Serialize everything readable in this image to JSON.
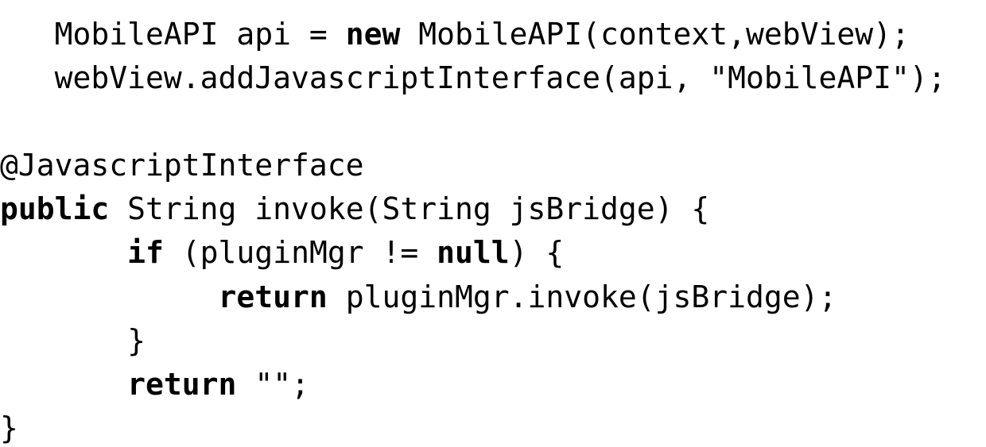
{
  "code": {
    "indent0": "",
    "indent1": "   ",
    "indent2": "       ",
    "indent3": "            ",
    "line1a": "MobileAPI api = ",
    "line1b": "new",
    "line1c": " MobileAPI(context,webView);",
    "line2": "webView.addJavascriptInterface(api, \"MobileAPI\");",
    "blank": "",
    "line4": "@JavascriptInterface",
    "line5a": "public",
    "line5b": " String invoke(String jsBridge) {",
    "line6a": "if",
    "line6b": " (pluginMgr != ",
    "line6c": "null",
    "line6d": ") {",
    "line7a": "return",
    "line7b": " pluginMgr.invoke(jsBridge);",
    "line8": "}",
    "line9a": "return",
    "line9b": " \"\";",
    "line10": "}"
  }
}
